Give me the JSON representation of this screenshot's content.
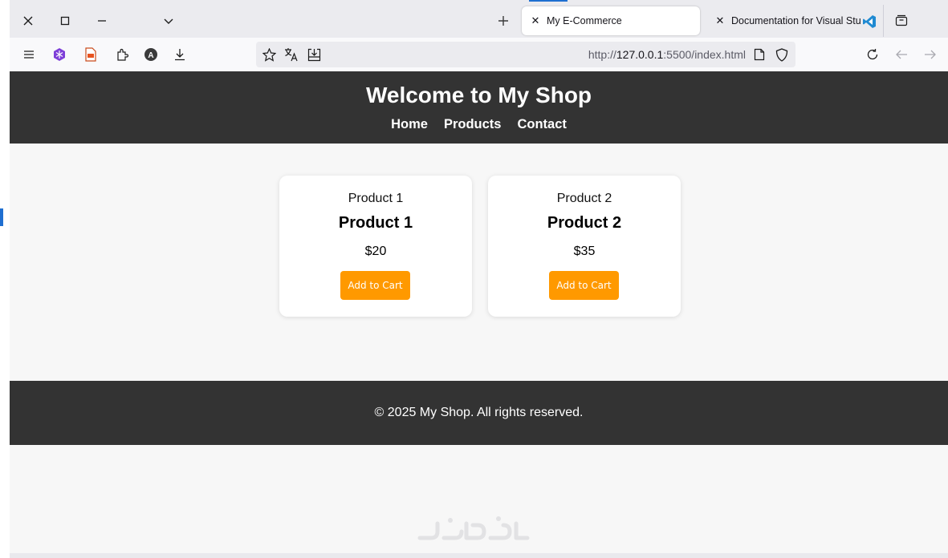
{
  "browser": {
    "tabs": [
      {
        "title": "My E-Commerce",
        "active": true
      },
      {
        "title": "Documentation for Visual Studio Code",
        "active": false
      }
    ],
    "url": {
      "scheme": "http://",
      "host": "127.0.0.1",
      "rest": ":5500/index.html"
    },
    "window_controls": [
      "close-icon",
      "maximize-icon",
      "minimize-icon",
      "chevron-down-icon"
    ],
    "toolbar_icons": [
      "menu-icon",
      "extension-snowflake-icon",
      "pdf-icon",
      "extensions-icon",
      "account-icon",
      "download-icon",
      "bookmark-star-icon",
      "translate-icon",
      "save-page-icon",
      "reader-view-icon",
      "shield-icon",
      "reload-icon",
      "back-icon",
      "forward-icon"
    ],
    "account_letter": "A"
  },
  "site": {
    "title": "Welcome to My Shop",
    "nav": [
      "Home",
      "Products",
      "Contact"
    ],
    "products": [
      {
        "image_label": "Product 1",
        "name": "Product 1",
        "price": "$20",
        "button": "Add to Cart"
      },
      {
        "image_label": "Product 2",
        "name": "Product 2",
        "price": "$35",
        "button": "Add to Cart"
      }
    ],
    "footer": "© 2025 My Shop. All rights reserved."
  },
  "colors": {
    "header_bg": "#333333",
    "button_bg": "#ff9900",
    "page_bg": "#f7f7f7",
    "browser_accent": "#1f6fd1"
  }
}
